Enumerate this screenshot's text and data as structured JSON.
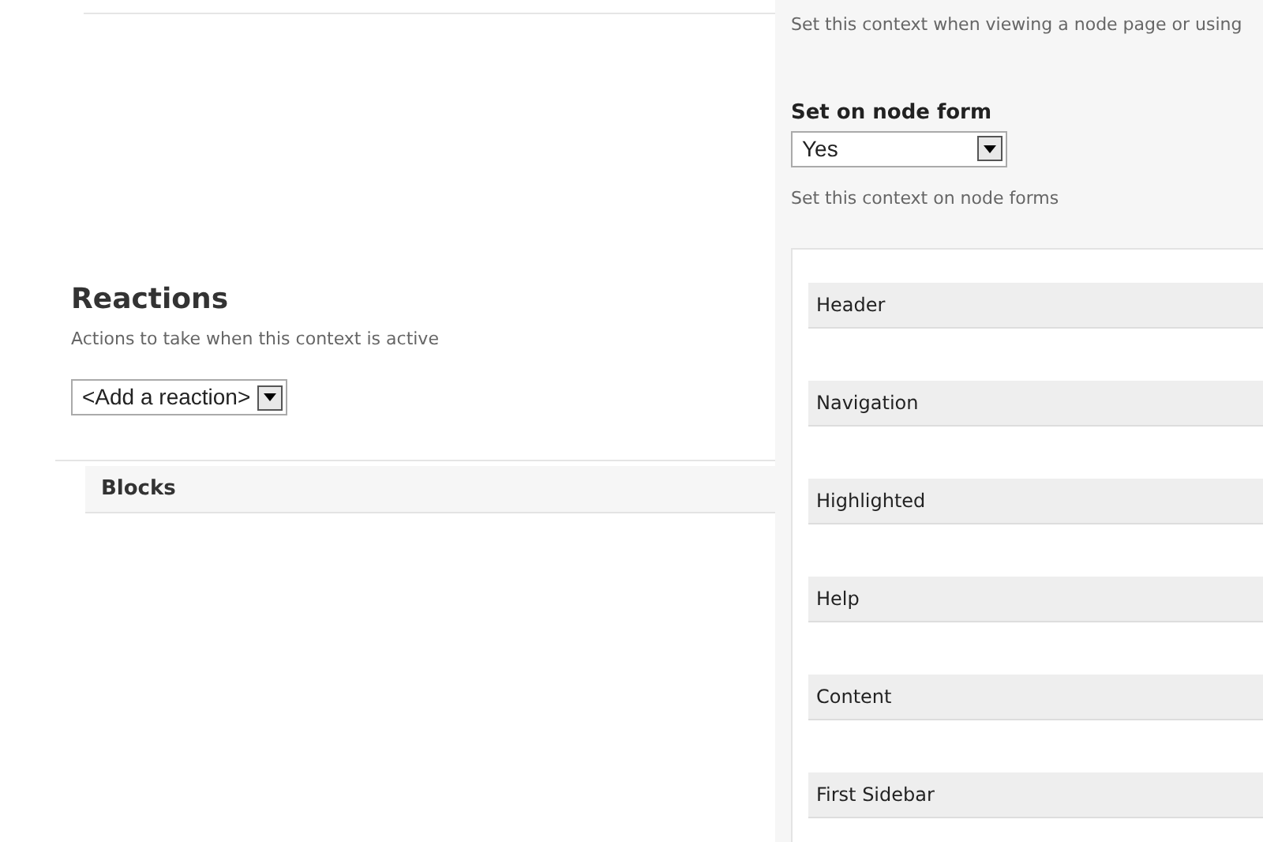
{
  "node_settings": {
    "description_top": "Set this context when viewing a node page or using",
    "set_on_node_form": {
      "label": "Set on node form",
      "value": "Yes",
      "description": "Set this context on node forms"
    }
  },
  "reactions": {
    "title": "Reactions",
    "description": "Actions to take when this context is active",
    "add_select": {
      "value": "<Add a reaction>"
    },
    "sections": [
      {
        "title": "Blocks"
      }
    ]
  },
  "regions": [
    {
      "title": "Header"
    },
    {
      "title": "Navigation"
    },
    {
      "title": "Highlighted"
    },
    {
      "title": "Help"
    },
    {
      "title": "Content"
    },
    {
      "title": "First Sidebar"
    }
  ]
}
